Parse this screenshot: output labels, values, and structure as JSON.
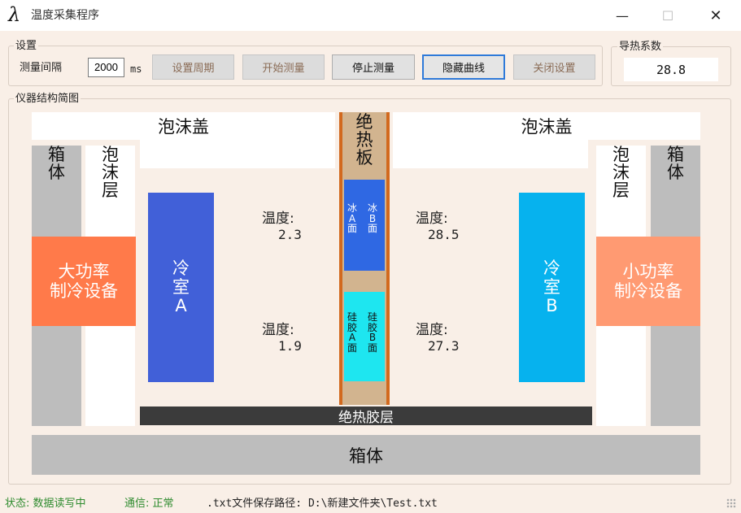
{
  "window": {
    "title": "温度采集程序",
    "icon_glyph": "λ",
    "min_glyph": "—",
    "max_glyph": "☐",
    "close_glyph": "✕"
  },
  "settings": {
    "group_label": "设置",
    "period_label": "测量间隔",
    "period_value": "2000",
    "period_unit": "ms",
    "buttons": {
      "set_period": "设置周期",
      "start_measure": "开始测量",
      "stop_measure": "停止测量",
      "hide_curve": "隐藏曲线",
      "close_settings": "关闭设置"
    }
  },
  "conductivity": {
    "group_label": "导热系数",
    "value": "28.8"
  },
  "diagram": {
    "group_label": "仪器结构简图",
    "foam_lid_left": "泡沫盖",
    "foam_lid_right": "泡沫盖",
    "box_left": "箱\n体",
    "foam_layer_left": "泡\n沫\n层",
    "foam_layer_right": "泡\n沫\n层",
    "box_right": "箱\n体",
    "high_power_cooler": "大功率\n制冷设备",
    "low_power_cooler": "小功率\n制冷设备",
    "cold_room_a": "冷\n室\nA",
    "cold_room_b": "冷\n室\nB",
    "insulation_board": "绝\n热\n板",
    "ice_a": "冰\nA\n面",
    "ice_b": "冰\nB\n面",
    "silica_a": "硅\n胶\nA\n面",
    "silica_b": "硅\n胶\nB\n面",
    "insulation_glue_layer": "绝热胶层",
    "box_bottom": "箱体",
    "temp_label": "温度:",
    "temp_ice_a": "2.3",
    "temp_ice_b": "28.5",
    "temp_silica_a": "1.9",
    "temp_silica_b": "27.3"
  },
  "status": {
    "state_label": "状态: 数据读写中",
    "comm_label": "通信: 正常",
    "save_path": ".txt文件保存路径: D:\\新建文件夹\\Test.txt",
    "state_color": "#2e8b2e",
    "comm_color": "#2e8b2e"
  },
  "colors": {
    "cold_room_a": "#4160d8",
    "cold_room_b": "#06b2ee",
    "high_power_cooler": "#ff7a4a",
    "low_power_cooler": "#ff9a72",
    "ice": "#2f68e3",
    "silica": "#1ee6f0",
    "insulation_board": "#d2b48f",
    "board_edge": "#d2691e",
    "glue_layer": "#3b3b3b",
    "box": "#bdbdbd"
  }
}
